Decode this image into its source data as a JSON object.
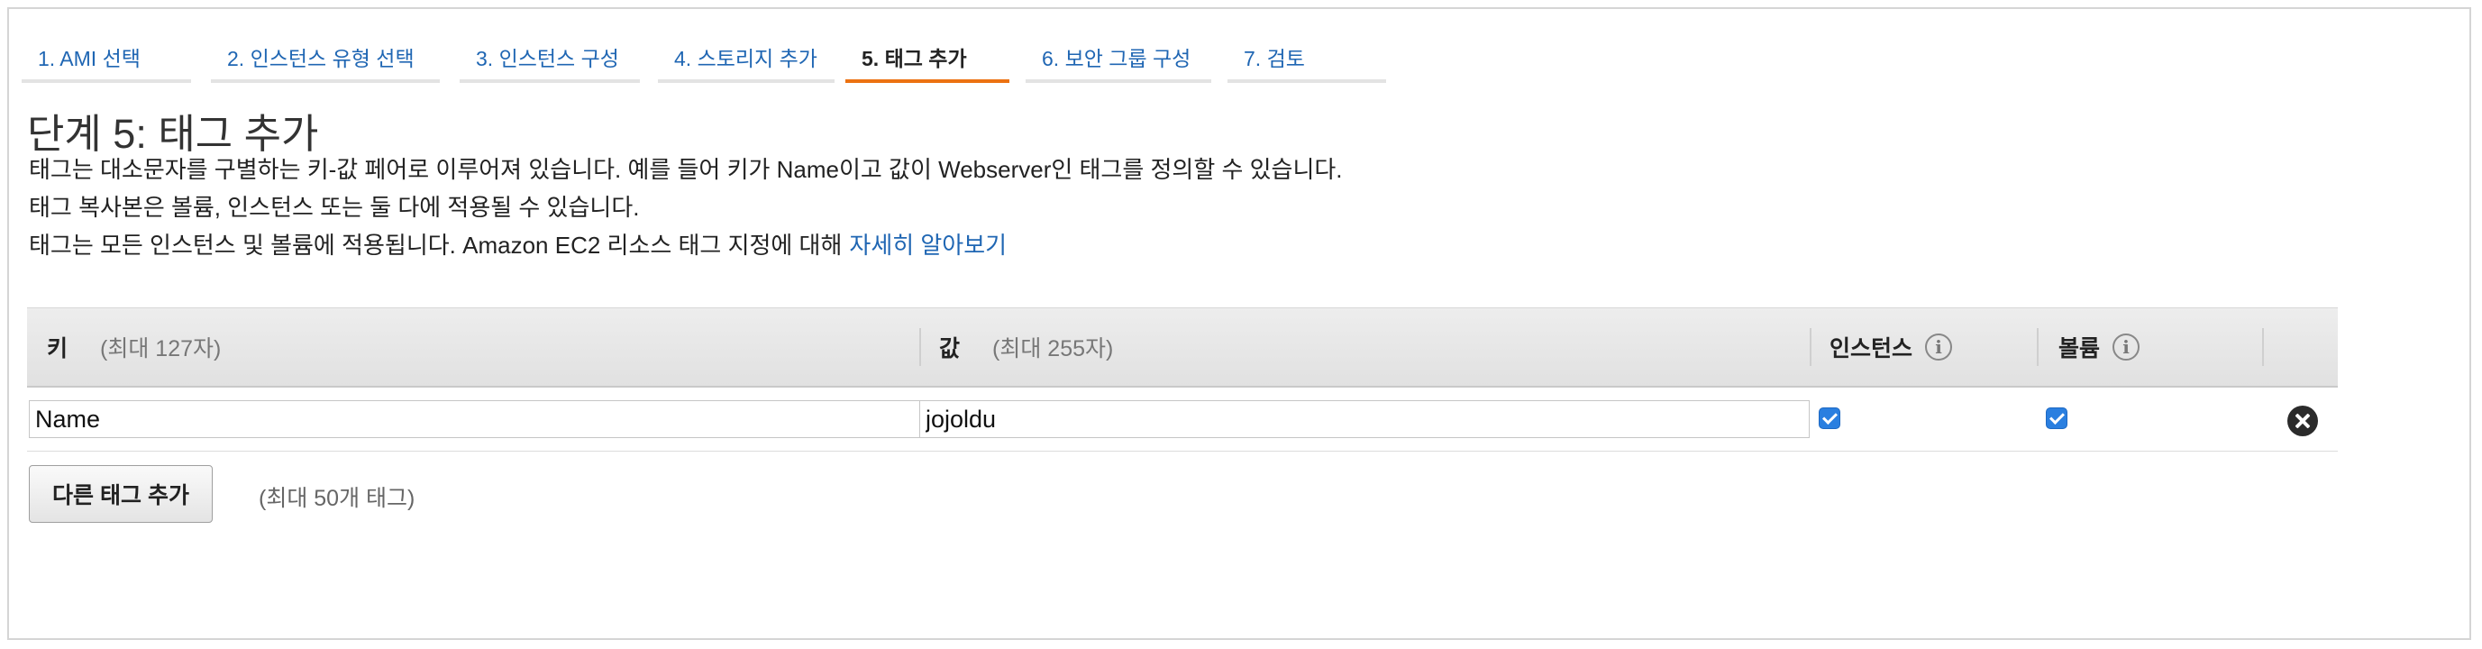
{
  "steps": [
    {
      "label": "1. AMI 선택"
    },
    {
      "label": "2. 인스턴스 유형 선택"
    },
    {
      "label": "3. 인스턴스 구성"
    },
    {
      "label": "4. 스토리지 추가"
    },
    {
      "label": "5. 태그 추가",
      "active": true
    },
    {
      "label": "6. 보안 그룹 구성"
    },
    {
      "label": "7. 검토"
    }
  ],
  "page": {
    "title": "단계 5: 태그 추가",
    "desc_line1": "태그는 대소문자를 구별하는 키-값 페어로 이루어져 있습니다. 예를 들어 키가 Name이고 값이 Webserver인 태그를 정의할 수 있습니다.",
    "desc_line2": "태그 복사본은 볼륨, 인스턴스 또는 둘 다에 적용될 수 있습니다.",
    "desc_line3": "태그는 모든 인스턴스 및 볼륨에 적용됩니다. Amazon EC2 리소스 태그 지정에 대해",
    "learn_more": "자세히 알아보기"
  },
  "table": {
    "headers": {
      "key": "키",
      "key_hint": "(최대 127자)",
      "value": "값",
      "value_hint": "(최대 255자)",
      "instances": "인스턴스",
      "volumes": "볼륨"
    },
    "rows": [
      {
        "key": "Name",
        "value": "jojoldu",
        "instances": true,
        "volumes": true
      }
    ]
  },
  "actions": {
    "add_tag": "다른 태그 추가",
    "add_tag_limit": "(최대 50개 태그)"
  },
  "icons": {
    "info": "info-icon",
    "remove": "close-circle-icon",
    "checkbox": "checkbox-checked-icon"
  },
  "colors": {
    "link": "#1f66b3",
    "active_step_underline": "#ec7211",
    "checkbox": "#2a7fe0"
  }
}
